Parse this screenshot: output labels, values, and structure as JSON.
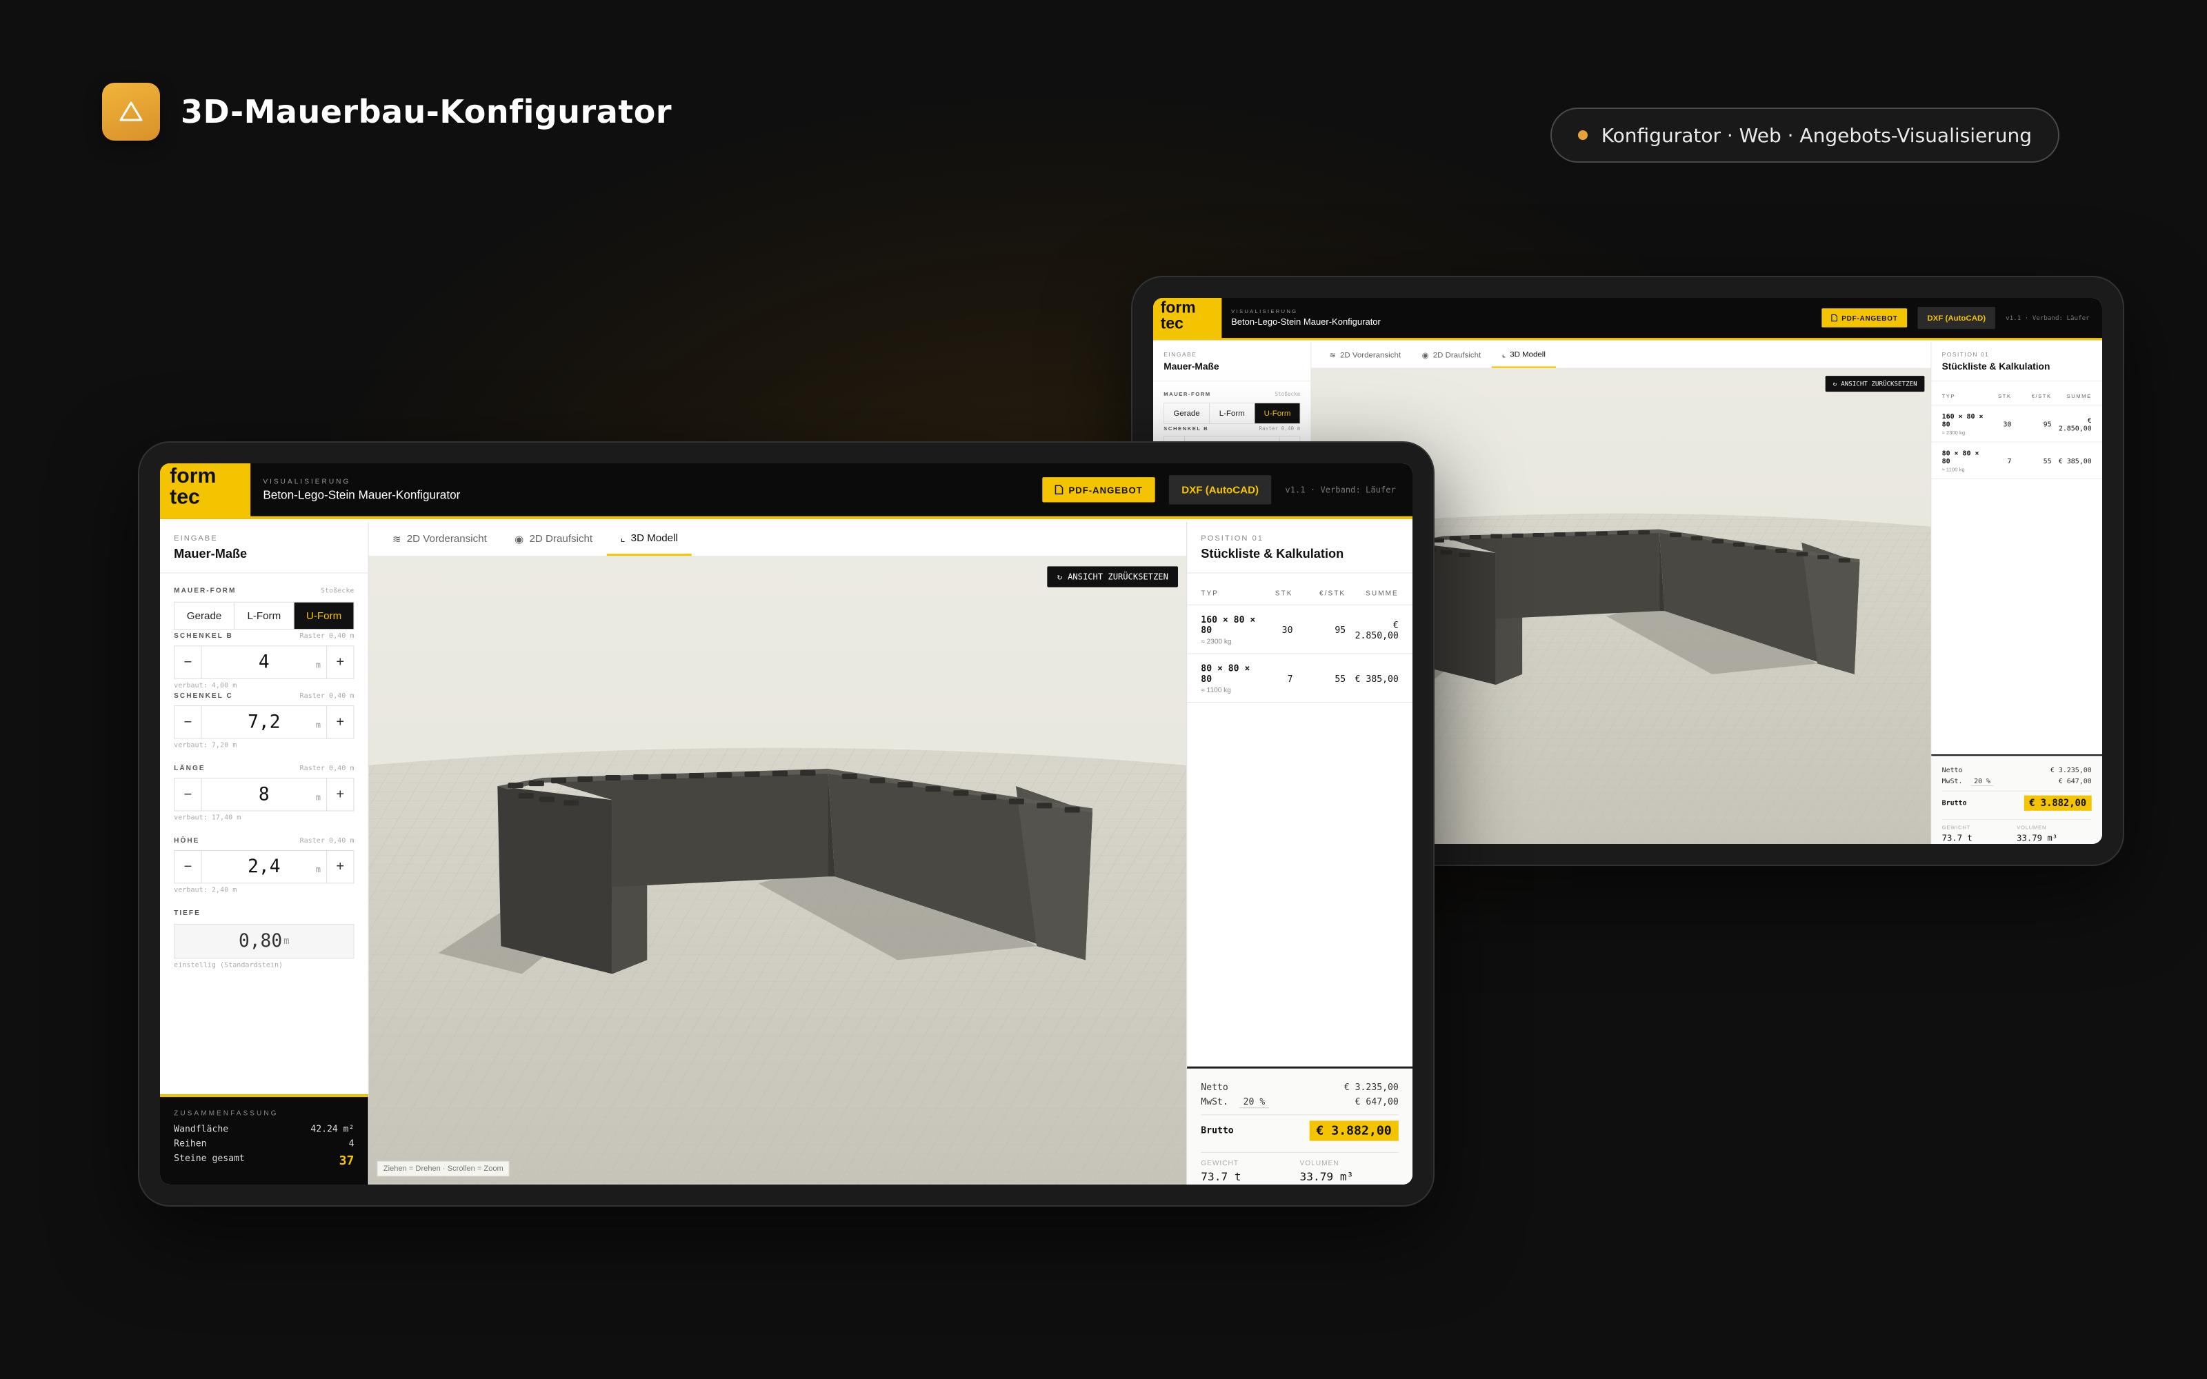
{
  "page": {
    "title": "3D-Mauerbau-Konfigurator",
    "tagline": "Konfigurator · Web · Angebots-Visualisierung",
    "accent": "#f5c400",
    "brand_accent": "#e8a23a"
  },
  "app": {
    "logo": "form tec",
    "kicker": "VISUALISIERUNG",
    "title": "Beton-Lego-Stein Mauer-Konfigurator",
    "pdf_button": "PDF-ANGEBOT",
    "dxf_button": "DXF (AutoCAD)",
    "version": "v1.1 · Verband: Läufer",
    "left": {
      "kicker": "EINGABE",
      "title": "Mauer-Maße",
      "shape_label": "MAUER-FORM",
      "shape_hint": "Stoßecke",
      "shapes": [
        "Gerade",
        "L-Form",
        "U-Form"
      ],
      "active_shape": "U-Form",
      "schenkel_b": {
        "label": "SCHENKEL B",
        "hint": "Raster 0,40 m",
        "value": "4",
        "unit": "m",
        "sub": "verbaut: 4,00 m"
      },
      "schenkel_c": {
        "label": "SCHENKEL C",
        "hint": "Raster 0,40 m",
        "value": "7,2",
        "unit": "m",
        "sub": "verbaut: 7,20 m"
      },
      "laenge": {
        "label": "LÄNGE",
        "hint": "Raster 0,40 m",
        "value": "8",
        "unit": "m",
        "sub": "verbaut: 17,40 m"
      },
      "hoehe": {
        "label": "HÖHE",
        "hint": "Raster 0,40 m",
        "value": "2,4",
        "unit": "m",
        "sub": "verbaut: 2,40 m"
      },
      "tiefe": {
        "label": "TIEFE",
        "value": "0,80",
        "unit": "m",
        "sub": "einstellig (Standardstein)"
      },
      "minus": "−",
      "plus": "+"
    },
    "summary": {
      "kicker": "ZUSAMMENFASSUNG",
      "rows": [
        {
          "label": "Wandfläche",
          "value": "42.24 m²"
        },
        {
          "label": "Reihen",
          "value": "4"
        },
        {
          "label": "Steine gesamt",
          "value": "37"
        }
      ]
    },
    "tabs": [
      "2D Vorderansicht",
      "2D Draufsicht",
      "3D Modell"
    ],
    "active_tab": "3D Modell",
    "reset_button": "ANSICHT ZURÜCKSETZEN",
    "viewport_hint": "Ziehen = Drehen · Scrollen = Zoom",
    "right": {
      "kicker": "POSITION 01",
      "title": "Stückliste & Kalkulation",
      "columns": [
        "TYP",
        "STK",
        "€/STK",
        "SUMME"
      ],
      "rows": [
        {
          "typ": "160 × 80 × 80",
          "weight": "≈ 2300 kg",
          "stk": "30",
          "price": "95",
          "sum": "€ 2.850,00"
        },
        {
          "typ": "80 × 80 × 80",
          "weight": "≈ 1100 kg",
          "stk": "7",
          "price": "55",
          "sum": "€ 385,00"
        }
      ],
      "netto_label": "Netto",
      "netto": "€ 3.235,00",
      "mwst_label": "MwSt.",
      "mwst_rate": "20 %",
      "mwst": "€ 647,00",
      "brutto_label": "Brutto",
      "brutto": "€ 3.882,00",
      "gewicht_label": "GEWICHT",
      "gewicht": "73.7 t",
      "volumen_label": "VOLUMEN",
      "volumen": "33.79 m³"
    }
  }
}
